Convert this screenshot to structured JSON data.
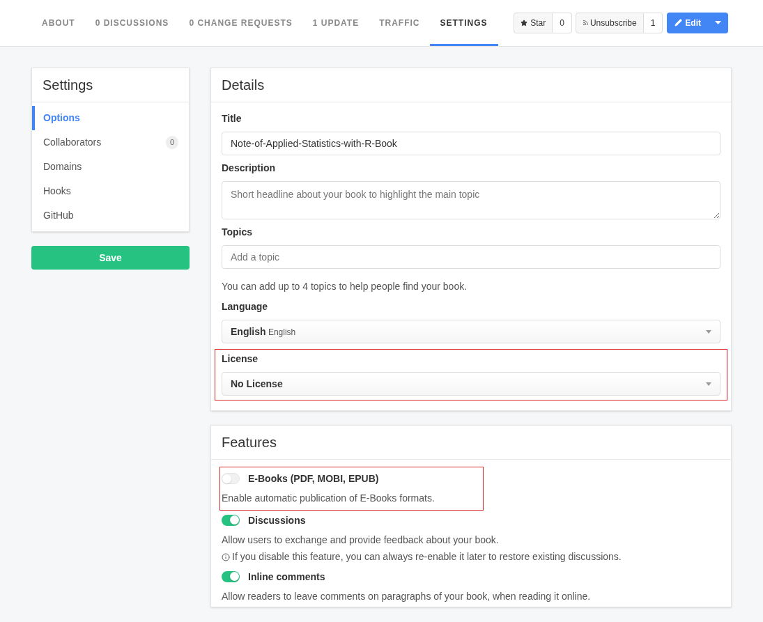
{
  "tabs": [
    {
      "label": "ABOUT",
      "selected": false
    },
    {
      "label": "0 DISCUSSIONS",
      "selected": false
    },
    {
      "label": "0 CHANGE REQUESTS",
      "selected": false
    },
    {
      "label": "1 UPDATE",
      "selected": false
    },
    {
      "label": "TRAFFIC",
      "selected": false
    },
    {
      "label": "SETTINGS",
      "selected": true
    }
  ],
  "actions": {
    "star": {
      "label": "Star",
      "count": "0"
    },
    "unsubscribe": {
      "label": "Unsubscribe",
      "count": "1"
    },
    "edit": {
      "label": "Edit"
    }
  },
  "sidebar": {
    "title": "Settings",
    "items": [
      {
        "label": "Options",
        "selected": true
      },
      {
        "label": "Collaborators",
        "selected": false,
        "badge": "0"
      },
      {
        "label": "Domains",
        "selected": false
      },
      {
        "label": "Hooks",
        "selected": false
      },
      {
        "label": "GitHub",
        "selected": false
      }
    ],
    "save": "Save"
  },
  "details": {
    "title": "Details",
    "fields": [
      {
        "kind": "input",
        "label": "Title",
        "value": "Note-of-Applied-Statistics-with-R-Book",
        "highlighted": false
      },
      {
        "kind": "textarea",
        "label": "Description",
        "placeholder": "Short headline about your book to highlight the main topic",
        "highlighted": false
      },
      {
        "kind": "input",
        "label": "Topics",
        "placeholder": "Add a topic",
        "help": "You can add up to 4 topics to help people find your book.",
        "highlighted": false
      },
      {
        "kind": "select",
        "label": "Language",
        "value": "English",
        "subvalue": "English",
        "highlighted": false
      },
      {
        "kind": "select",
        "label": "License",
        "value": "No License",
        "highlighted": true
      }
    ]
  },
  "features": {
    "title": "Features",
    "items": [
      {
        "label": "E-Books (PDF, MOBI, EPUB)",
        "on": false,
        "description": "Enable automatic publication of E-Books formats.",
        "highlighted": true
      },
      {
        "label": "Discussions",
        "on": true,
        "description": "Allow users to exchange and provide feedback about your book.",
        "note": "If you disable this feature, you can always re-enable it later to restore existing discussions.",
        "highlighted": false
      },
      {
        "label": "Inline comments",
        "on": true,
        "description": "Allow readers to leave comments on paragraphs of your book, when reading it online.",
        "highlighted": false
      }
    ]
  }
}
